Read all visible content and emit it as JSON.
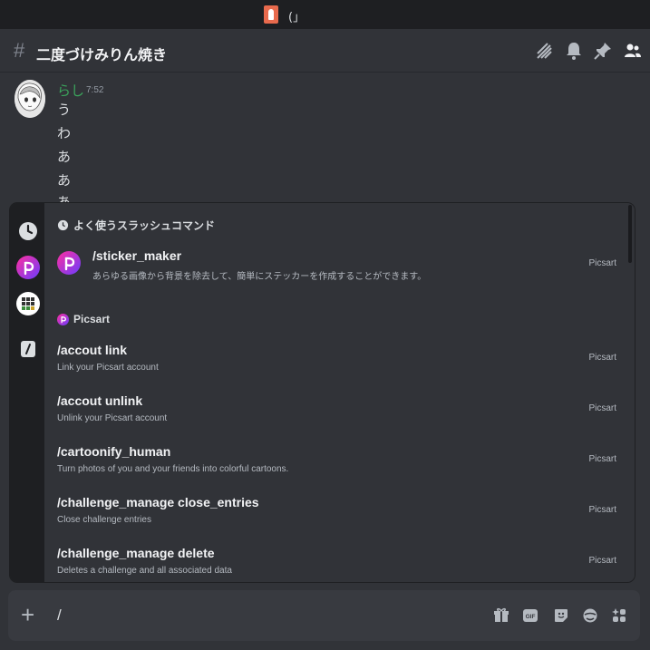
{
  "window": {
    "title": "(」",
    "app_icon": "app-icon"
  },
  "channel": {
    "hash": "#",
    "name": "二度づけみりん焼き",
    "header_icons": [
      "threads-icon",
      "bell-icon",
      "pin-icon",
      "members-icon"
    ]
  },
  "message": {
    "author": "らし",
    "author_color": "#3ba55c",
    "time": "7:52",
    "lines": [
      "う",
      "わ",
      "あ",
      "あ",
      "あ"
    ]
  },
  "autocomplete": {
    "rail_icons": [
      "clock-icon",
      "picsart-icon",
      "grid-app-icon",
      "slash-icon"
    ],
    "frequent_header": "よく使うスラッシュコマンド",
    "frequent": {
      "command": "/sticker_maker",
      "description": "あらゆる画像から背景を除去して、簡単にステッカーを作成することができます。",
      "source": "Picsart"
    },
    "app_header": "Picsart",
    "commands": [
      {
        "command": "/accout link",
        "description": "Link your Picsart account",
        "source": "Picsart"
      },
      {
        "command": "/accout unlink",
        "description": "Unlink your Picsart account",
        "source": "Picsart"
      },
      {
        "command": "/cartoonify_human",
        "description": "Turn photos of you and your friends into colorful cartoons.",
        "source": "Picsart"
      },
      {
        "command": "/challenge_manage close_entries",
        "description": "Close challenge entries",
        "source": "Picsart"
      },
      {
        "command": "/challenge_manage delete",
        "description": "Deletes a challenge and all associated data",
        "source": "Picsart"
      }
    ]
  },
  "composer": {
    "plus": "+",
    "value": "/",
    "icons": [
      "gift-icon",
      "gif-icon",
      "sticker-icon",
      "emoji-icon",
      "apps-icon"
    ],
    "gif_label": "GIF"
  },
  "colors": {
    "accent_green": "#3ba55c",
    "background": "#313338",
    "picsart_gradient": [
      "#ff2fa0",
      "#7a3cff"
    ]
  }
}
